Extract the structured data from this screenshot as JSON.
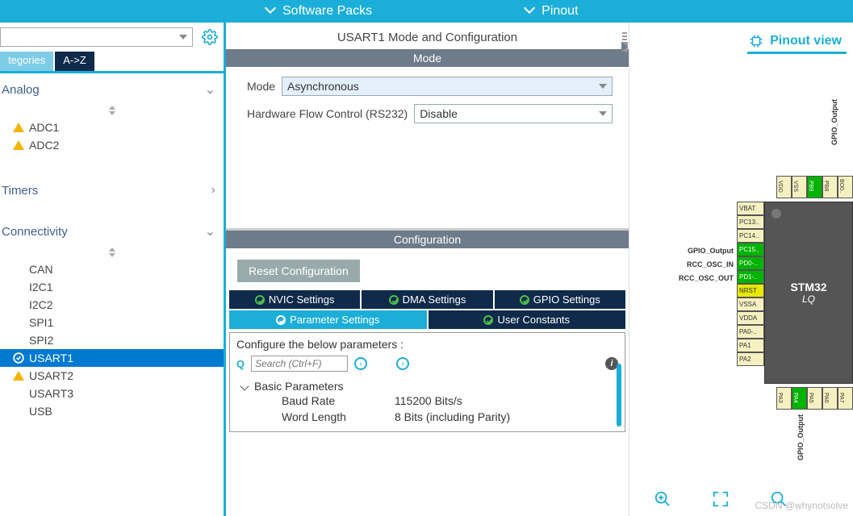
{
  "topbar": {
    "software_packs": "Software Packs",
    "pinout": "Pinout"
  },
  "sidebar": {
    "tabs": {
      "categories": "tegories",
      "az": "A->Z"
    },
    "cat_analog": "Analog",
    "cat_timers": "Timers",
    "cat_connectivity": "Connectivity",
    "analog": {
      "adc1": "ADC1",
      "adc2": "ADC2"
    },
    "conn": {
      "can": "CAN",
      "i2c1": "I2C1",
      "i2c2": "I2C2",
      "spi1": "SPI1",
      "spi2": "SPI2",
      "usart1": "USART1",
      "usart2": "USART2",
      "usart3": "USART3",
      "usb": "USB"
    }
  },
  "center": {
    "title": "USART1 Mode and Configuration",
    "mode_h": "Mode",
    "mode_label": "Mode",
    "mode_value": "Asynchronous",
    "hw_label": "Hardware Flow Control (RS232)",
    "hw_value": "Disable",
    "config_h": "Configuration",
    "reset_btn": "Reset Configuration",
    "tabs": {
      "nvic": "NVIC Settings",
      "dma": "DMA Settings",
      "gpio": "GPIO Settings",
      "param": "Parameter Settings",
      "user": "User Constants"
    },
    "param_intro": "Configure the below parameters :",
    "search_ph": "Search (Ctrl+F)",
    "group_basic": "Basic Parameters",
    "baud_k": "Baud Rate",
    "baud_v": "115200 Bits/s",
    "word_k": "Word Length",
    "word_v": "8 Bits (including Parity)"
  },
  "right": {
    "pinout_view": "Pinout view",
    "chip_name": "STM32",
    "chip_pkg": "LQ",
    "gpio_output": "GPIO_Output",
    "rcc_in": "RCC_OSC_IN",
    "rcc_out": "RCC_OSC_OUT",
    "top_pins": [
      "VDD",
      "VSS",
      "PB9",
      "PB8",
      "BO0.."
    ],
    "left_pins": [
      "VBAT",
      "PC13..",
      "PC14..",
      "PC15..",
      "PD0-..",
      "PD1-..",
      "NRST",
      "VSSA",
      "VDDA",
      "PA0-..",
      "PA1",
      "PA2"
    ],
    "bot_pins": [
      "PA3",
      "PA4",
      "PA5",
      "PA6",
      "PA7"
    ]
  },
  "watermark": "CSDN @whynotsolve"
}
